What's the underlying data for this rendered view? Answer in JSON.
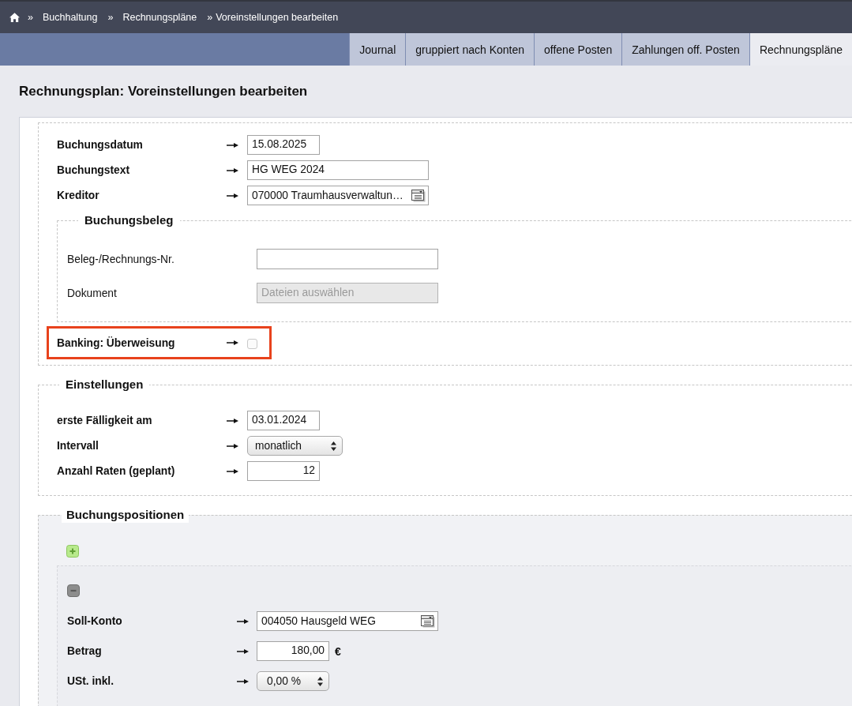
{
  "breadcrumb": {
    "crumbs": [
      {
        "separator": "»",
        "label": "Buchhaltung"
      },
      {
        "separator": "»",
        "label": "Rechnungspläne"
      },
      {
        "separator": "»",
        "label": "Voreinstellungen bearbeiten"
      }
    ]
  },
  "tabs": [
    {
      "label": "Journal",
      "selected": false
    },
    {
      "label": "gruppiert nach Konten",
      "selected": false
    },
    {
      "label": "offene Posten",
      "selected": false
    },
    {
      "label": "Zahlungen off. Posten",
      "selected": false
    },
    {
      "label": "Rechnungspläne",
      "selected": true
    }
  ],
  "page_title": "Rechnungsplan: Voreinstellungen bearbeiten",
  "booking": {
    "fields": [
      {
        "kind": "date",
        "label": "Buchungsdatum",
        "value": "15.08.2025"
      },
      {
        "kind": "text",
        "label": "Buchungstext",
        "value": "HG WEG 2024"
      },
      {
        "kind": "lookup",
        "label": "Kreditor",
        "value": "070000 Traumhausverwaltun…"
      }
    ],
    "voucher": {
      "title": "Buchungsbeleg",
      "fields": [
        {
          "label": "Beleg-/Rechnungs-Nr.",
          "disabled": false
        },
        {
          "label": "Dokument",
          "placeholder": "Dateien auswählen",
          "disabled": true
        }
      ]
    },
    "banking": {
      "label": "Banking: Überweisung",
      "checked": false,
      "highlighted": true
    }
  },
  "settings": {
    "title": "Einstellungen",
    "fields": [
      {
        "kind": "date",
        "label": "erste Fälligkeit am",
        "value": "03.01.2024"
      },
      {
        "kind": "select",
        "label": "Intervall",
        "value": "monatlich"
      },
      {
        "kind": "number",
        "label": "Anzahl Raten (geplant)",
        "value": "12"
      }
    ]
  },
  "positions": {
    "title": "Buchungspositionen",
    "entries": [
      {
        "fields": [
          {
            "kind": "lookup",
            "label": "Soll-Konto",
            "value": "004050 Hausgeld WEG"
          },
          {
            "kind": "number",
            "label": "Betrag",
            "value": "180,00",
            "unit": "€"
          },
          {
            "kind": "select",
            "label": "USt. inkl.",
            "value": "0,00 %"
          }
        ]
      }
    ]
  }
}
